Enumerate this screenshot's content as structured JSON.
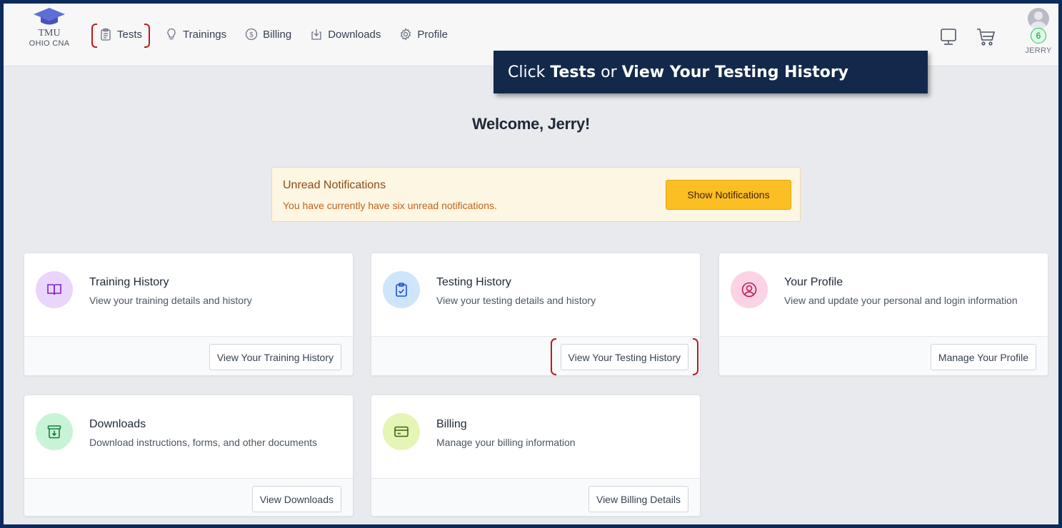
{
  "logo": {
    "line1": "TMU",
    "line2": "OHIO CNA"
  },
  "nav": {
    "items": [
      {
        "label": "Tests",
        "icon": "clipboard-icon"
      },
      {
        "label": "Trainings",
        "icon": "lightbulb-icon"
      },
      {
        "label": "Billing",
        "icon": "dollar-circle-icon"
      },
      {
        "label": "Downloads",
        "icon": "download-tray-icon"
      },
      {
        "label": "Profile",
        "icon": "gear-icon"
      }
    ]
  },
  "user": {
    "name": "JERRY",
    "badge_count": "6"
  },
  "callout": {
    "pre": "Click ",
    "bold1": "Tests",
    "mid": " or ",
    "bold2": "View Your Testing History"
  },
  "welcome": "Welcome, Jerry!",
  "notification": {
    "title": "Unread Notifications",
    "text": "You have currently have six unread notifications.",
    "button": "Show Notifications"
  },
  "cards": [
    {
      "title": "Training History",
      "desc": "View your training details and history",
      "button": "View Your Training History",
      "icon": "book-icon",
      "icon_bg": "#ead5fb",
      "icon_color": "#7e22ce"
    },
    {
      "title": "Testing History",
      "desc": "View your testing details and history",
      "button": "View Your Testing History",
      "icon": "clipboard-check-icon",
      "icon_bg": "#cfe5fb",
      "icon_color": "#1d4ed8"
    },
    {
      "title": "Your Profile",
      "desc": "View and update your personal and login information",
      "button": "Manage Your Profile",
      "icon": "user-circle-icon",
      "icon_bg": "#fbd3e4",
      "icon_color": "#be185d"
    },
    {
      "title": "Downloads",
      "desc": "Download instructions, forms, and other documents",
      "button": "View Downloads",
      "icon": "archive-download-icon",
      "icon_bg": "#c8f3d7",
      "icon_color": "#15803d"
    },
    {
      "title": "Billing",
      "desc": "Manage your billing information",
      "button": "View Billing Details",
      "icon": "credit-card-icon",
      "icon_bg": "#e4f5b5",
      "icon_color": "#3f6212"
    }
  ],
  "colors": {
    "frame": "#0d2a5c",
    "callout_bg": "#13294b",
    "highlight": "#b91c1c",
    "notif_button": "#fbbf24"
  }
}
